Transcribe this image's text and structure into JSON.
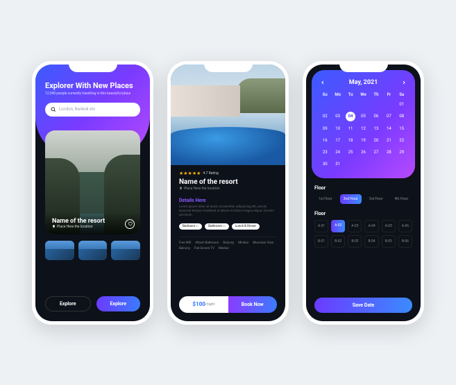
{
  "screen1": {
    "title": "Explorer With New Places",
    "subtitle": "12,540 people currently travelling in this beautyful place",
    "search_placeholder": "London, Bankok etc",
    "card": {
      "name": "Name of the resort",
      "location": "Place Here the location"
    },
    "btn_left": "Explore",
    "btn_right": "Explore"
  },
  "screen2": {
    "rating_text": "4.7 Rating",
    "name": "Name of the resort",
    "location": "Place Here the location",
    "details_label": "Details Here",
    "lorem": "Lorem ipsum dolor sit amet, consectetur adipisicing elit, sed do eiusmod tempor incididunt ut labore et dolore magna aliqua. Ut enim ad minim",
    "pills": [
      {
        "label": "Bedroom",
        "count": "03"
      },
      {
        "label": "Bathroom",
        "count": "02"
      },
      {
        "label": "Lunch & Dinner",
        "count": ""
      }
    ],
    "features": [
      "Free Wifi",
      "Attach Bathroom",
      "Balcony",
      "Minibar",
      "Mountain View",
      "Balcony",
      "Flat Screen TV",
      "Minibar"
    ],
    "price": "$100",
    "price_unit": "/night",
    "book_label": "Book Now"
  },
  "screen3": {
    "month": "May, 2021",
    "dow": [
      "Su",
      "Mo",
      "Tu",
      "We",
      "Th",
      "Fr",
      "Sa"
    ],
    "days": [
      "",
      "",
      "",
      "",
      "",
      "",
      "01",
      "02",
      "03",
      "04",
      "05",
      "06",
      "07",
      "08",
      "09",
      "10",
      "11",
      "12",
      "13",
      "14",
      "15",
      "16",
      "17",
      "18",
      "19",
      "20",
      "21",
      "22",
      "23",
      "24",
      "25",
      "26",
      "27",
      "28",
      "29",
      "30",
      "31"
    ],
    "selected_day": "04",
    "floor_label": "Floor",
    "floors": [
      "1st Floor",
      "2nd Floor",
      "3rd Floor",
      "4th Floor"
    ],
    "floor_selected": 1,
    "rooms_label": "Floor",
    "rooms": [
      "A-01",
      "A-02",
      "A-03",
      "A-04",
      "A-05",
      "A-06",
      "B-01",
      "B-02",
      "B-03",
      "B-04",
      "B-05",
      "B-06"
    ],
    "room_selected": 1,
    "save_label": "Save Date"
  }
}
